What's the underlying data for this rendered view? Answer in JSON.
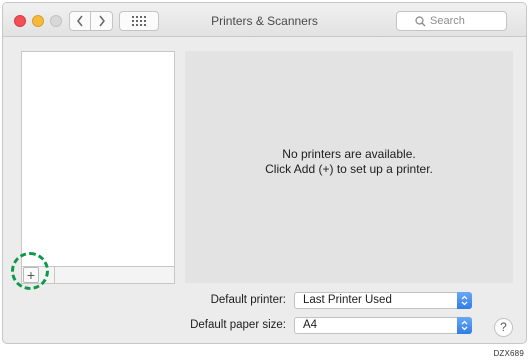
{
  "window": {
    "title": "Printers & Scanners"
  },
  "toolbar": {
    "search_placeholder": "Search"
  },
  "icons": {
    "back": "chevron-left-icon",
    "forward": "chevron-right-icon",
    "show_all": "grid-icon",
    "search": "magnifier-icon",
    "add": "plus-icon",
    "help": "question-mark-icon"
  },
  "sidebar": {
    "add_label": "+"
  },
  "main": {
    "message_line1": "No printers are available.",
    "message_line2": "Click Add (+) to set up a printer."
  },
  "settings": {
    "default_printer_label": "Default printer:",
    "default_printer_value": "Last Printer Used",
    "paper_size_label": "Default paper size:",
    "paper_size_value": "A4"
  },
  "help_label": "?",
  "figure_id": "DZX689",
  "colors": {
    "highlight": "#0b9a48",
    "accent": "#2f7de6"
  }
}
